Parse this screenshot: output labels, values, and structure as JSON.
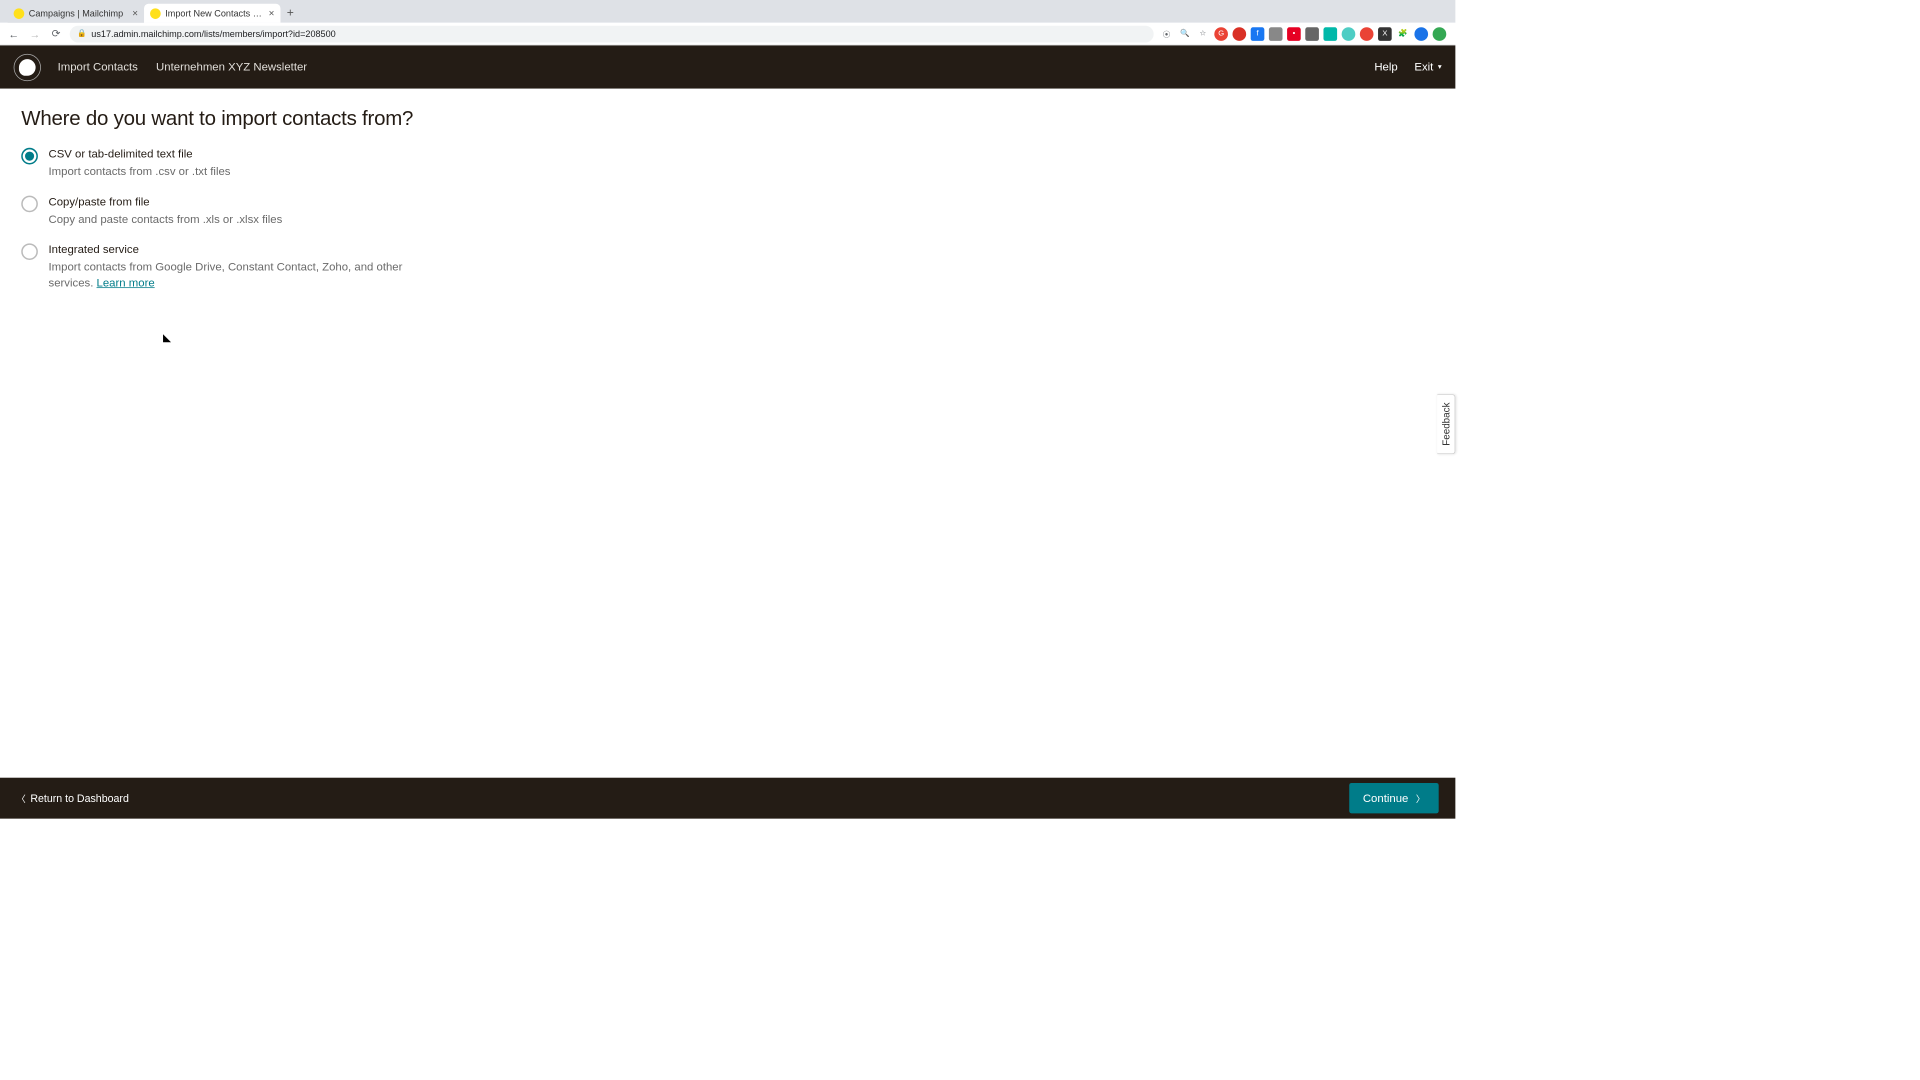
{
  "browser": {
    "tabs": [
      {
        "title": "Campaigns | Mailchimp",
        "active": false
      },
      {
        "title": "Import New Contacts | Mailch",
        "active": true
      }
    ],
    "url": "us17.admin.mailchimp.com/lists/members/import?id=208500"
  },
  "header": {
    "breadcrumb1": "Import Contacts",
    "breadcrumb2": "Unternehmen XYZ Newsletter",
    "help": "Help",
    "exit": "Exit"
  },
  "page": {
    "title": "Where do you want to import contacts from?",
    "options": [
      {
        "label": "CSV or tab-delimited text file",
        "desc": "Import contacts from .csv or .txt files",
        "selected": true
      },
      {
        "label": "Copy/paste from file",
        "desc": "Copy and paste contacts from .xls or .xlsx files",
        "selected": false
      },
      {
        "label": "Integrated service",
        "desc": "Import contacts from Google Drive, Constant Contact, Zoho, and other services. ",
        "learn_more": "Learn more",
        "selected": false
      }
    ]
  },
  "feedback": "Feedback",
  "footer": {
    "return": "Return to Dashboard",
    "continue": "Continue"
  }
}
